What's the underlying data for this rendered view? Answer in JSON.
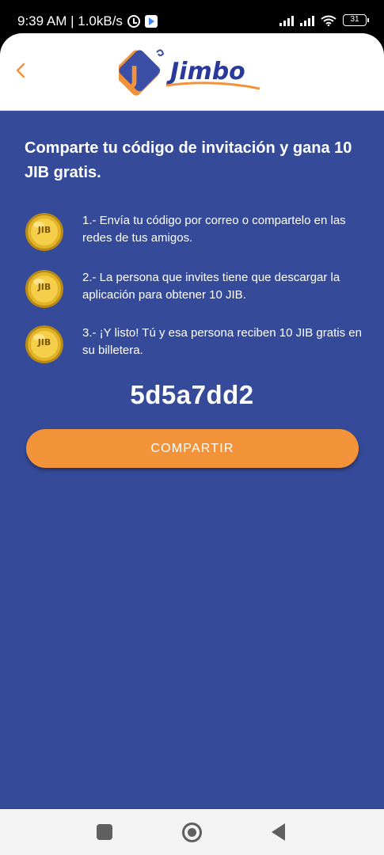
{
  "status_bar": {
    "time_speed": "9:39 AM | 1.0kB/s",
    "battery": "31"
  },
  "header": {
    "logo_letter": "J",
    "logo_text": "Jimbo"
  },
  "main": {
    "headline": "Comparte tu código de invitación y gana 10 JIB gratis.",
    "coin_label": "JIB",
    "steps": [
      {
        "text": "1.- Envía tu código por correo o compartelo en las redes de tus amigos."
      },
      {
        "text": "2.- La persona que invites tiene que descargar la aplicación para obtener 10 JIB."
      },
      {
        "text": "3.- ¡Y listo! Tú y esa persona reciben 10 JIB gratis en su billetera."
      }
    ],
    "invite_code": "5d5a7dd2",
    "share_label": "COMPARTIR"
  },
  "colors": {
    "background": "#354a98",
    "accent": "#f2933a",
    "back_arrow": "#f2933a"
  },
  "icons": {
    "back": "chevron-left-icon",
    "coin": "jib-coin-icon",
    "nav_recents": "square-icon",
    "nav_home": "circle-icon",
    "nav_back": "triangle-back-icon"
  }
}
